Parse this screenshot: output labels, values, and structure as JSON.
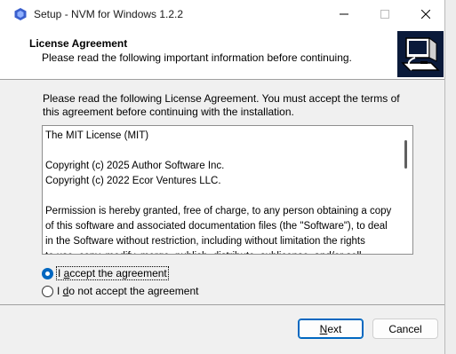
{
  "window": {
    "title": "Setup - NVM for Windows 1.2.2"
  },
  "header": {
    "title": "License Agreement",
    "subtitle": "Please read the following important information before continuing."
  },
  "intro": "Please read the following License Agreement. You must accept the terms of this agreement before continuing with the installation.",
  "license": {
    "text": "The MIT License (MIT)\n\nCopyright (c) 2025 Author Software Inc.\nCopyright (c) 2022 Ecor Ventures LLC.\n\nPermission is hereby granted, free of charge, to any person obtaining a copy\nof this software and associated documentation files (the \"Software\"), to deal\nin the Software without restriction, including without limitation the rights\nto use, copy, modify, merge, publish, distribute, sublicense, and/or sell"
  },
  "radios": {
    "accept": {
      "prefix": "I ",
      "accel": "a",
      "rest": "ccept the agreement",
      "checked": true
    },
    "decline": {
      "prefix": "I ",
      "accel": "d",
      "rest": "o not accept the agreement",
      "checked": false
    }
  },
  "buttons": {
    "next": {
      "accel": "N",
      "rest": "ext"
    },
    "cancel": "Cancel"
  },
  "colors": {
    "accent": "#0067c0",
    "app_icon": "#3a5fcd"
  }
}
